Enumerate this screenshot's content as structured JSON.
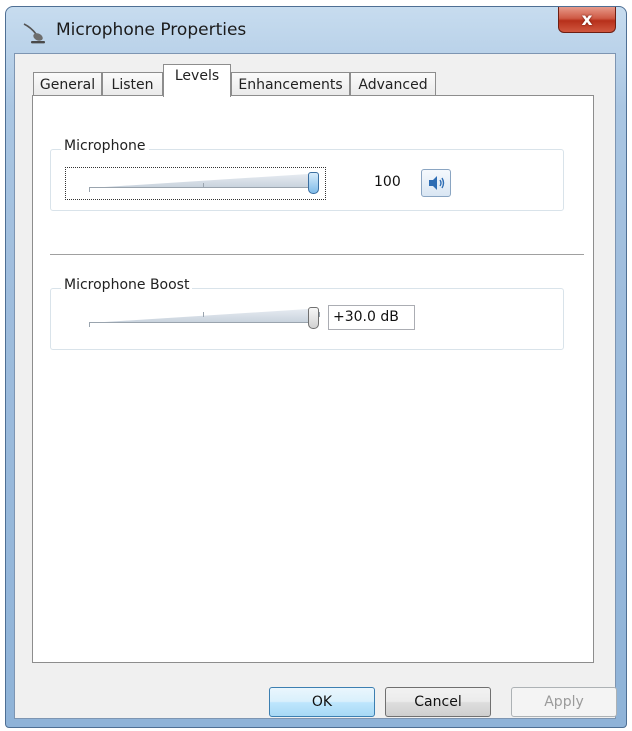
{
  "window": {
    "title": "Microphone Properties",
    "icon": "microphone-icon",
    "close_label": "x"
  },
  "tabs": [
    {
      "label": "General"
    },
    {
      "label": "Listen"
    },
    {
      "label": "Levels"
    },
    {
      "label": "Enhancements"
    },
    {
      "label": "Advanced"
    }
  ],
  "selected_tab": "Levels",
  "levels": {
    "microphone": {
      "label": "Microphone",
      "value_text": "100",
      "level_percent": 100,
      "mute_button_icon": "speaker-icon"
    },
    "boost": {
      "label": "Microphone Boost",
      "value_text": "+30.0 dB",
      "level_percent": 100
    }
  },
  "buttons": {
    "ok": "OK",
    "cancel": "Cancel",
    "apply": "Apply"
  },
  "colors": {
    "ok_border": "#3c7fb1",
    "close_red": "#c13d28",
    "slider_thumb_blue": "#7fbbe9"
  }
}
